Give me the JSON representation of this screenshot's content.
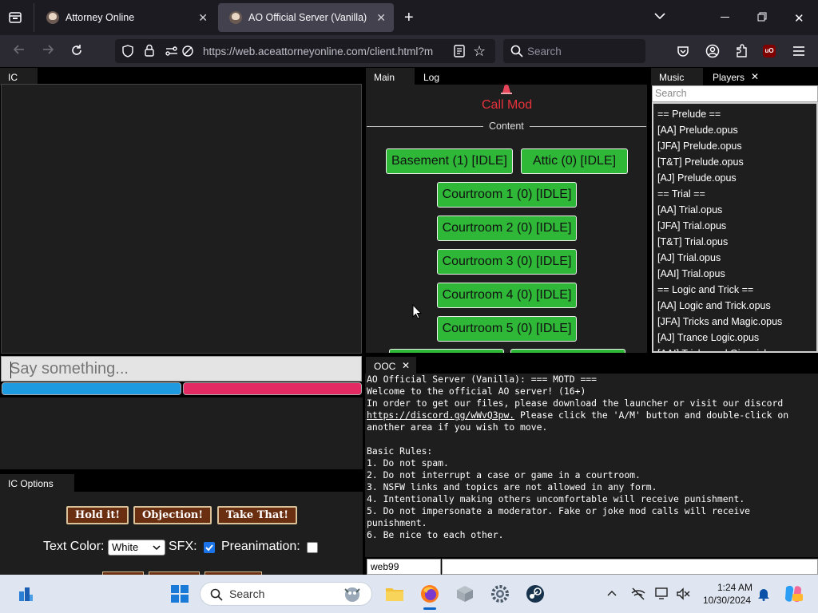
{
  "browser": {
    "tabs": [
      {
        "title": "Attorney Online",
        "active": false
      },
      {
        "title": "AO Official Server (Vanilla)",
        "active": true
      }
    ],
    "url": "https://web.aceattorneyonline.com/client.html?m",
    "url_domain": "aceattorneyonline.com",
    "search_placeholder": "Search",
    "accent": "#2b2a33"
  },
  "ic": {
    "tab_label": "IC",
    "input_placeholder": "Say something...",
    "health_bar_colors": {
      "defense": "#1d9ae0",
      "prosecution": "#e32a63"
    }
  },
  "ic_options": {
    "tab_label": "IC Options",
    "shout_buttons": [
      "Hold it!",
      "Objection!",
      "Take That!"
    ],
    "text_color_label": "Text Color:",
    "text_color_value": "White",
    "sfx_label": "SFX:",
    "sfx_checked": true,
    "preanimation_label": "Preanimation:",
    "preanimation_checked": false
  },
  "main_panel": {
    "tabs": [
      "Main",
      "Log"
    ],
    "call_mod_label": "Call Mod",
    "content_label": "Content",
    "areas": [
      "Basement (1) [IDLE]",
      "Attic (0) [IDLE]",
      "Courtroom 1 (0) [IDLE]",
      "Courtroom 2 (0) [IDLE]",
      "Courtroom 3 (0) [IDLE]",
      "Courtroom 4 (0) [IDLE]",
      "Courtroom 5 (0) [IDLE]"
    ],
    "area_color": "#2fb738"
  },
  "music_panel": {
    "tabs": [
      "Music",
      "Players"
    ],
    "search_placeholder": "Search",
    "songs": [
      "== Prelude ==",
      "[AA] Prelude.opus",
      "[JFA] Prelude.opus",
      "[T&T] Prelude.opus",
      "[AJ] Prelude.opus",
      "== Trial ==",
      "[AA] Trial.opus",
      "[JFA] Trial.opus",
      "[T&T] Trial.opus",
      "[AJ] Trial.opus",
      "[AAI] Trial.opus",
      "== Logic and Trick ==",
      "[AA] Logic and Trick.opus",
      "[JFA] Tricks and Magic.opus",
      "[AJ] Trance Logic.opus",
      "[AAI] Tricks and Gimmicks.opus"
    ]
  },
  "ooc": {
    "tab_label": "OOC",
    "lines": [
      "AO Official Server (Vanilla): === MOTD ===",
      "Welcome to the official AO server! (16+)",
      "In order to get our files, please download the launcher or visit our discord",
      "https://discord.gg/wWvQ3pw. Please click the 'A/M' button and double-click on",
      "another area if you wish to move.",
      "",
      "Basic Rules:",
      "1. Do not spam.",
      "2. Do not interrupt a case or game in a courtroom.",
      "3. NSFW links and topics are not allowed in any form.",
      "4. Intentionally making others uncomfortable will receive punishment.",
      "5. Do not impersonate a moderator. Fake or joke mod calls will receive",
      "punishment.",
      "6. Be nice to each other."
    ],
    "discord_link": "https://discord.gg/wWvQ3pw.",
    "name_value": "web99"
  },
  "taskbar": {
    "search_placeholder": "Search",
    "time": "1:24 AM",
    "date": "10/30/2024"
  }
}
